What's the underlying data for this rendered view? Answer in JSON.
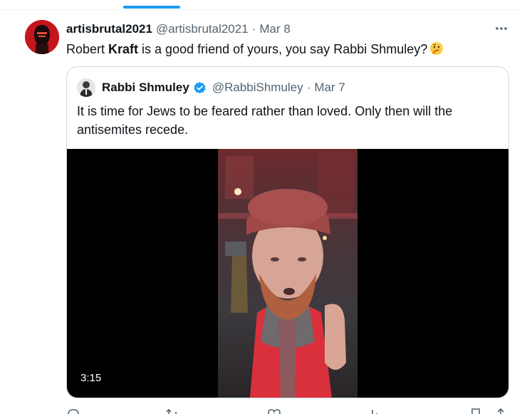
{
  "tweet": {
    "display_name": "artisbrutal2021",
    "handle": "@artisbrutal2021",
    "separator": "·",
    "date": "Mar 8",
    "text_before": "Robert ",
    "text_bold": "Kraft",
    "text_after": " is a good friend of yours, you say Rabbi Shmuley?",
    "emoji": "thinking-face-emoji"
  },
  "quote": {
    "display_name": "Rabbi Shmuley",
    "verified": true,
    "handle": "@RabbiShmuley",
    "separator": "·",
    "date": "Mar 7",
    "text": "It is time for Jews to be feared rather than loved. Only then will the antisemites recede.",
    "video": {
      "duration": "3:15"
    }
  },
  "icons": [
    "more-icon",
    "verified-badge-icon",
    "reply-icon",
    "retweet-icon",
    "like-icon",
    "views-icon",
    "bookmark-icon",
    "share-icon"
  ],
  "colors": {
    "accent": "#1d9bf0",
    "text": "#0f1419",
    "secondary": "#536471",
    "border": "#cfd9de",
    "avatar_red": "#c4161c"
  }
}
